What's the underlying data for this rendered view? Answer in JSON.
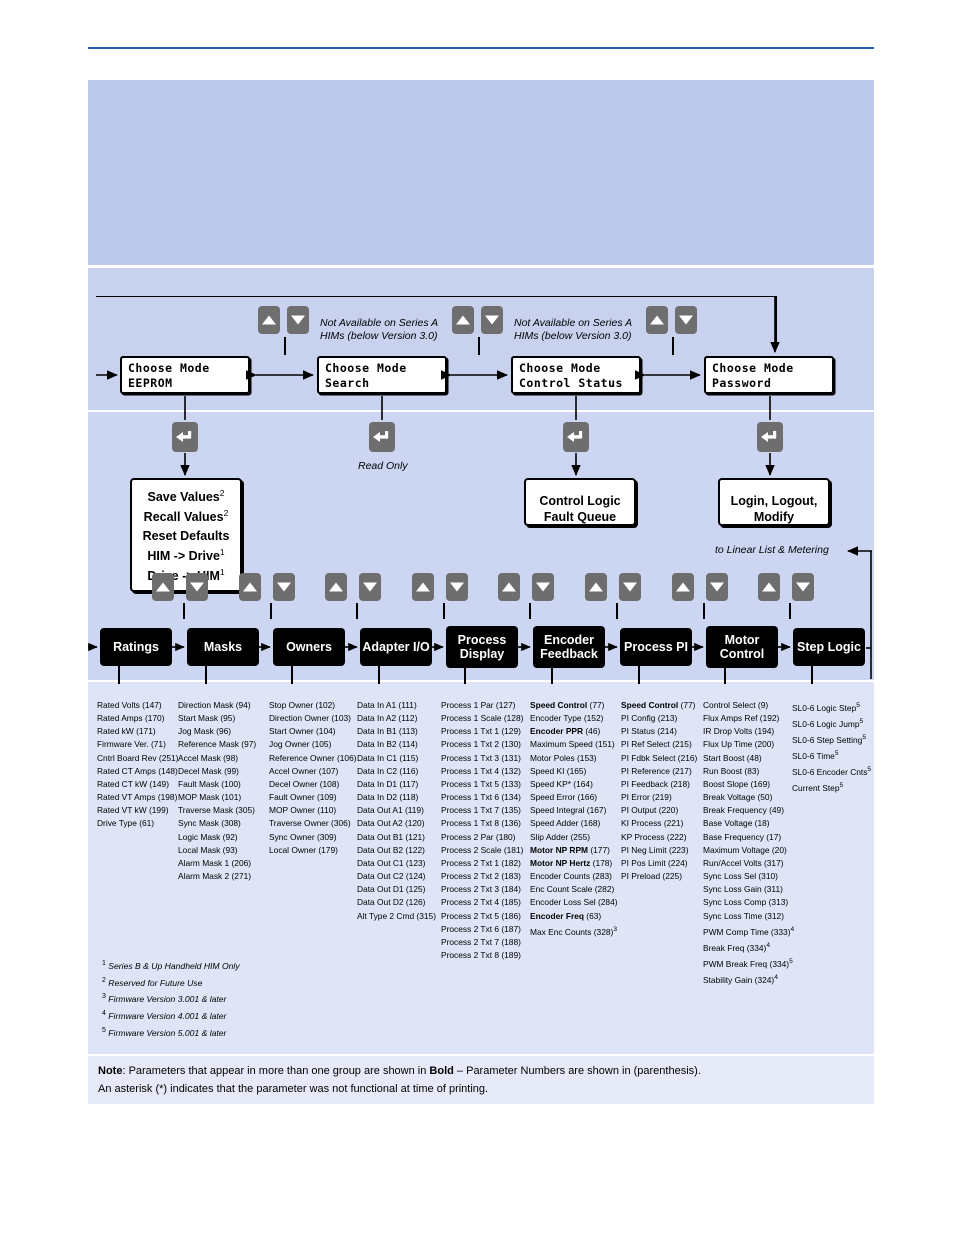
{
  "mode_screens": [
    {
      "name": "eeprom",
      "line1": "Choose Mode",
      "line2": "EEPROM",
      "pad1": "     ",
      "pad2": "      "
    },
    {
      "name": "search",
      "line1": "Choose Mode",
      "line2": "Search",
      "pad1": "     ",
      "pad2": "      "
    },
    {
      "name": "control",
      "line1": "Choose Mode",
      "line2": "Control Status",
      "pad1": "     ",
      "pad2": ""
    },
    {
      "name": "password",
      "line1": "Choose Mode",
      "line2": "Password",
      "pad1": "     ",
      "pad2": "    "
    }
  ],
  "annotations": {
    "not_available_1": "Not Available on Series A\nHIMs (below Version 3.0)",
    "not_available_2": "Not Available on Series A\nHIMs (below Version 3.0)",
    "read_only": "Read Only",
    "to_linear_list": "to Linear List & Metering"
  },
  "action_boxes": [
    {
      "name": "eeprom-actions",
      "lines": [
        {
          "text": "Save Values",
          "sup": "2"
        },
        {
          "text": "Recall Values",
          "sup": "2"
        },
        {
          "text": "Reset Defaults",
          "sup": ""
        },
        {
          "text": "HIM -> Drive",
          "sup": "1"
        },
        {
          "text": "Drive -> HIM",
          "sup": "1"
        }
      ]
    },
    {
      "name": "control-status-actions",
      "lines": [
        {
          "text": "Control Logic",
          "sup": ""
        },
        {
          "text": "Fault Queue",
          "sup": ""
        }
      ]
    },
    {
      "name": "password-actions",
      "lines": [
        {
          "text": "Login, Logout,",
          "sup": ""
        },
        {
          "text": "Modify",
          "sup": ""
        }
      ]
    }
  ],
  "groups": [
    {
      "label": "Ratings"
    },
    {
      "label": "Masks"
    },
    {
      "label": "Owners"
    },
    {
      "label": "Adapter I/O"
    },
    {
      "label": "Process\nDisplay"
    },
    {
      "label": "Encoder\nFeedback"
    },
    {
      "label": "Process PI"
    },
    {
      "label": "Motor\nControl"
    },
    {
      "label": "Step Logic"
    }
  ],
  "parameter_columns": [
    {
      "group": "Ratings",
      "items": [
        {
          "t": "Rated Volts (147)"
        },
        {
          "t": "Rated Amps (170)"
        },
        {
          "t": "Rated kW (171)"
        },
        {
          "t": "Firmware Ver. (71)"
        },
        {
          "t": "Cntrl Board Rev (251)"
        },
        {
          "t": "Rated CT Amps (148)"
        },
        {
          "t": "Rated CT kW (149)"
        },
        {
          "t": "Rated VT Amps (198)"
        },
        {
          "t": "Rated VT kW (199)"
        },
        {
          "t": "Drive Type (61)"
        }
      ]
    },
    {
      "group": "Masks",
      "items": [
        {
          "t": "Direction Mask (94)"
        },
        {
          "t": "Start Mask (95)"
        },
        {
          "t": "Jog Mask (96)"
        },
        {
          "t": "Reference Mask (97)"
        },
        {
          "t": "Accel Mask (98)"
        },
        {
          "t": "Decel Mask (99)"
        },
        {
          "t": "Fault Mask (100)"
        },
        {
          "t": "MOP Mask (101)"
        },
        {
          "t": "Traverse Mask (305)"
        },
        {
          "t": "Sync Mask (308)"
        },
        {
          "t": "Logic Mask (92)"
        },
        {
          "t": "Local Mask (93)"
        },
        {
          "t": "Alarm Mask 1 (206)"
        },
        {
          "t": "Alarm Mask 2 (271)"
        }
      ]
    },
    {
      "group": "Owners",
      "items": [
        {
          "t": "Stop Owner (102)"
        },
        {
          "t": "Direction Owner (103)"
        },
        {
          "t": "Start Owner (104)"
        },
        {
          "t": "Jog Owner (105)"
        },
        {
          "t": "Reference Owner (106)"
        },
        {
          "t": "Accel Owner (107)"
        },
        {
          "t": "Decel Owner (108)"
        },
        {
          "t": "Fault Owner (109)"
        },
        {
          "t": "MOP Owner (110)"
        },
        {
          "t": "Traverse Owner (306)"
        },
        {
          "t": "Sync Owner (309)"
        },
        {
          "t": "Local Owner (179)"
        }
      ]
    },
    {
      "group": "Adapter I/O",
      "items": [
        {
          "t": "Data In A1 (111)"
        },
        {
          "t": "Data In A2 (112)"
        },
        {
          "t": "Data In B1 (113)"
        },
        {
          "t": "Data In B2 (114)"
        },
        {
          "t": "Data In C1 (115)"
        },
        {
          "t": "Data In C2 (116)"
        },
        {
          "t": "Data In D1 (117)"
        },
        {
          "t": "Data In D2 (118)"
        },
        {
          "t": "Data Out A1 (119)"
        },
        {
          "t": "Data Out A2 (120)"
        },
        {
          "t": "Data Out B1 (121)"
        },
        {
          "t": "Data Out B2 (122)"
        },
        {
          "t": "Data Out C1 (123)"
        },
        {
          "t": "Data Out C2 (124)"
        },
        {
          "t": "Data Out D1 (125)"
        },
        {
          "t": "Data Out D2 (126)"
        },
        {
          "t": "Alt Type 2 Cmd (315)"
        }
      ]
    },
    {
      "group": "Process Display",
      "items": [
        {
          "t": "Process 1 Par (127)"
        },
        {
          "t": "Process 1 Scale (128)"
        },
        {
          "t": "Process 1 Txt 1 (129)"
        },
        {
          "t": "Process 1 Txt 2 (130)"
        },
        {
          "t": "Process 1 Txt 3 (131)"
        },
        {
          "t": "Process 1 Txt 4 (132)"
        },
        {
          "t": "Process 1 Txt 5 (133)"
        },
        {
          "t": "Process 1 Txt 6 (134)"
        },
        {
          "t": "Process 1 Txt 7 (135)"
        },
        {
          "t": "Process 1 Txt 8 (136)"
        },
        {
          "t": "Process 2 Par (180)"
        },
        {
          "t": "Process 2 Scale (181)"
        },
        {
          "t": "Process 2 Txt 1 (182)"
        },
        {
          "t": "Process 2 Txt 2 (183)"
        },
        {
          "t": "Process 2 Txt 3 (184)"
        },
        {
          "t": "Process 2 Txt 4 (185)"
        },
        {
          "t": "Process 2 Txt 5 (186)"
        },
        {
          "t": "Process 2 Txt 6 (187)"
        },
        {
          "t": "Process 2 Txt 7 (188)"
        },
        {
          "t": "Process 2 Txt 8 (189)"
        }
      ]
    },
    {
      "group": "Encoder Feedback",
      "items": [
        {
          "b": "Speed Control",
          "t": " (77)"
        },
        {
          "t": "Encoder Type (152)"
        },
        {
          "b": "Encoder PPR",
          "t": " (46)"
        },
        {
          "t": "Maximum Speed (151)"
        },
        {
          "t": "Motor Poles (153)"
        },
        {
          "t": "Speed KI (165)"
        },
        {
          "t": "Speed KP* (164)"
        },
        {
          "t": "Speed Error (166)"
        },
        {
          "t": "Speed Integral (167)"
        },
        {
          "t": "Speed Adder (168)"
        },
        {
          "t": "Slip Adder (255)"
        },
        {
          "b": "Motor NP RPM",
          "t": " (177)"
        },
        {
          "b": "Motor NP Hertz",
          "t": " (178)"
        },
        {
          "t": "Encoder Counts (283)"
        },
        {
          "t": "Enc Count Scale (282)"
        },
        {
          "t": "Encoder Loss Sel (284)"
        },
        {
          "b": "Encoder Freq",
          "t": " (63)"
        },
        {
          "t": "Max Enc Counts (328)",
          "sup": "3"
        }
      ]
    },
    {
      "group": "Process PI",
      "items": [
        {
          "b": "Speed Control",
          "t": " (77)"
        },
        {
          "t": "PI Config (213)"
        },
        {
          "t": "PI Status (214)"
        },
        {
          "t": "PI Ref Select (215)"
        },
        {
          "t": "PI Fdbk Select (216)"
        },
        {
          "t": "PI Reference (217)"
        },
        {
          "t": "PI Feedback (218)"
        },
        {
          "t": "PI Error (219)"
        },
        {
          "t": "PI Output (220)"
        },
        {
          "t": "KI Process (221)"
        },
        {
          "t": "KP Process (222)"
        },
        {
          "t": "PI Neg Limit (223)"
        },
        {
          "t": "PI Pos Limit (224)"
        },
        {
          "t": "PI Preload (225)"
        }
      ]
    },
    {
      "group": "Motor Control",
      "items": [
        {
          "t": "Control Select (9)"
        },
        {
          "t": "Flux Amps Ref (192)"
        },
        {
          "t": "IR Drop Volts (194)"
        },
        {
          "t": "Flux Up Time (200)"
        },
        {
          "t": "Start Boost (48)"
        },
        {
          "t": "Run Boost (83)"
        },
        {
          "t": "Boost Slope (169)"
        },
        {
          "t": "Break Voltage (50)"
        },
        {
          "t": "Break Frequency (49)"
        },
        {
          "t": "Base Voltage (18)"
        },
        {
          "t": "Base Frequency (17)"
        },
        {
          "t": "Maximum Voltage (20)"
        },
        {
          "t": "Run/Accel Volts (317)"
        },
        {
          "t": "Sync Loss Sel (310)"
        },
        {
          "t": "Sync Loss Gain (311)"
        },
        {
          "t": "Sync Loss Comp (313)"
        },
        {
          "t": "Sync Loss Time (312)"
        },
        {
          "t": "PWM Comp Time (333)",
          "sup": "4"
        },
        {
          "t": "Break Freq (334)",
          "sup": "4"
        },
        {
          "t": "PWM Break Freq (334)",
          "sup": "5"
        },
        {
          "t": "Stability Gain (324)",
          "sup": "4"
        }
      ]
    },
    {
      "group": "Step Logic",
      "items": [
        {
          "t": "SL0-6 Logic Step",
          "sup": "5"
        },
        {
          "t": "SL0-6 Logic Jump",
          "sup": "5"
        },
        {
          "t": "SL0-6 Step Setting",
          "sup": "5"
        },
        {
          "t": "SL0-6 Time",
          "sup": "5"
        },
        {
          "t": "SL0-6 Encoder Cnts",
          "sup": "5"
        },
        {
          "t": "Current Step",
          "sup": "5"
        }
      ]
    }
  ],
  "footnotes": [
    {
      "num": "1",
      "text": "Series B & Up  Handheld HIM Only"
    },
    {
      "num": "2",
      "text": "Reserved for Future Use"
    },
    {
      "num": "3",
      "text": "Firmware Version 3.001 & later"
    },
    {
      "num": "4",
      "text": "Firmware Version 4.001 & later"
    },
    {
      "num": "5",
      "text": "Firmware Version 5.001 & later"
    }
  ],
  "note": {
    "label": "Note",
    "line1_a": ": Parameters that appear in more than one group are shown in ",
    "bold": "Bold",
    "line1_b": " – Parameter Numbers are shown in (parenthesis).",
    "line2": "An asterisk (*) indicates that the parameter was not functional at time of printing."
  },
  "colors": {
    "panel_blue": "#bcc9ea",
    "key_grey": "#6e6e6e",
    "rule_blue": "#1f5fa9",
    "box_black": "#000000"
  }
}
